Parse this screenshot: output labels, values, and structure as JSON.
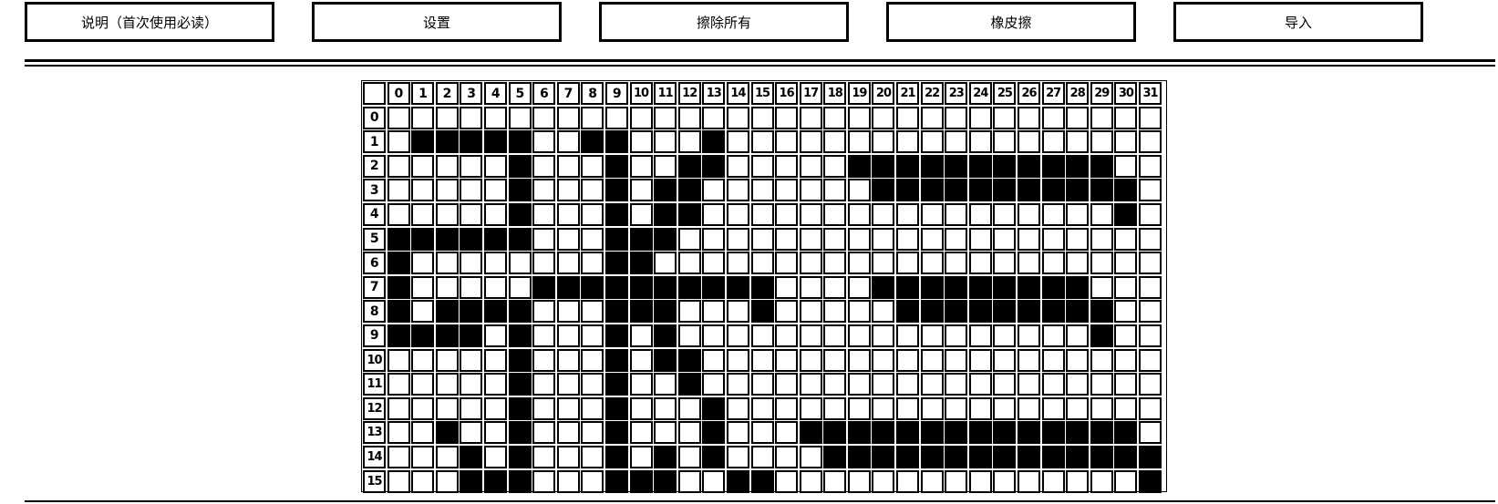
{
  "toolbar": {
    "buttons": [
      {
        "label": "说明（首次使用必读）"
      },
      {
        "label": "设置"
      },
      {
        "label": "擦除所有"
      },
      {
        "label": "橡皮擦"
      },
      {
        "label": "导入"
      }
    ]
  },
  "grid": {
    "columns": [
      "0",
      "1",
      "2",
      "3",
      "4",
      "5",
      "6",
      "7",
      "8",
      "9",
      "10",
      "11",
      "12",
      "13",
      "14",
      "15",
      "16",
      "17",
      "18",
      "19",
      "20",
      "21",
      "22",
      "23",
      "24",
      "25",
      "26",
      "27",
      "28",
      "29",
      "30",
      "31"
    ],
    "rows": [
      "0",
      "1",
      "2",
      "3",
      "4",
      "5",
      "6",
      "7",
      "8",
      "9",
      "10",
      "11",
      "12",
      "13",
      "14",
      "15"
    ],
    "filled": [
      [],
      [
        1,
        2,
        3,
        4,
        5,
        8,
        9,
        13
      ],
      [
        5,
        9,
        12,
        13,
        19,
        20,
        21,
        22,
        23,
        24,
        25,
        26,
        27,
        28,
        29
      ],
      [
        5,
        9,
        11,
        12,
        20,
        21,
        22,
        23,
        24,
        25,
        26,
        27,
        28,
        29,
        30
      ],
      [
        5,
        9,
        11,
        12,
        30
      ],
      [
        0,
        1,
        2,
        3,
        4,
        5,
        9,
        10,
        11
      ],
      [
        0,
        9,
        10
      ],
      [
        0,
        6,
        7,
        8,
        9,
        10,
        11,
        12,
        13,
        14,
        15,
        20,
        21,
        22,
        23,
        24,
        25,
        26,
        27,
        28
      ],
      [
        0,
        2,
        3,
        4,
        5,
        9,
        10,
        11,
        15,
        21,
        22,
        23,
        24,
        25,
        26,
        27,
        28,
        29
      ],
      [
        0,
        1,
        2,
        3,
        5,
        9,
        11,
        29
      ],
      [
        5,
        9,
        11,
        12
      ],
      [
        5,
        9,
        12
      ],
      [
        5,
        9,
        13
      ],
      [
        2,
        5,
        9,
        13,
        17,
        18,
        19,
        20,
        21,
        22,
        23,
        24,
        25,
        26,
        27,
        28,
        29,
        30
      ],
      [
        3,
        5,
        9,
        11,
        13,
        18,
        19,
        20,
        21,
        22,
        23,
        24,
        25,
        26,
        27,
        28,
        29,
        30,
        31
      ],
      [
        3,
        4,
        5,
        9,
        10,
        11,
        14,
        15,
        31
      ]
    ]
  }
}
